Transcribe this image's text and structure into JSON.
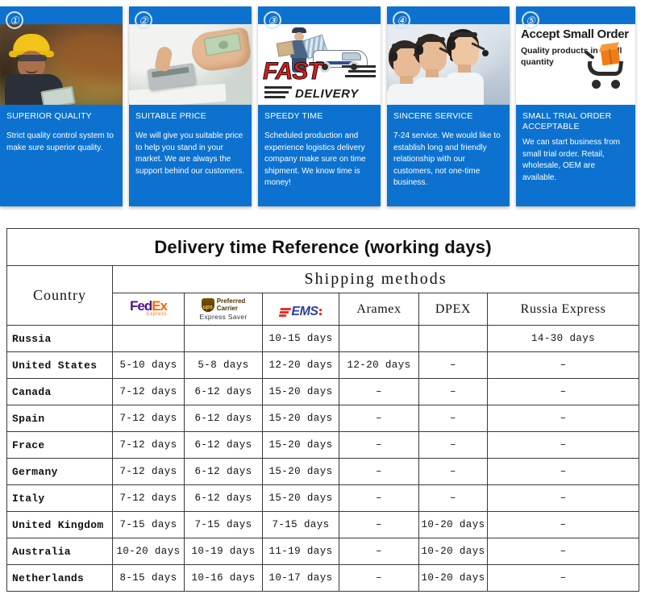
{
  "cards": [
    {
      "number": "①",
      "title": "SUPERIOR QUALITY",
      "body": "Strict quality control system to make sure superior quality.",
      "image_name": "factory-worker-photo"
    },
    {
      "number": "②",
      "title": "SUITABLE PRICE",
      "body": "We will give you suitable price to help you stand in your market. We are always the support behind our customers.",
      "image_name": "calculator-money-photo"
    },
    {
      "number": "③",
      "title": "SPEEDY TIME",
      "body": "Scheduled production and experience logistics delivery company make sure on time shipment. We know time is money!",
      "image_name": "fast-delivery-graphic",
      "graphic": {
        "word1": "FAST",
        "word2": "DELIVERY"
      }
    },
    {
      "number": "④",
      "title": "SINCERE SERVICE",
      "body": "7-24 service. We would like to establish long and friendly relationship with our customers, not one-time business.",
      "image_name": "call-center-photo"
    },
    {
      "number": "⑤",
      "title": "SMALL TRIAL ORDER ACCEPTABLE",
      "body": "We can start business from small trial order. Retail, wholesale, OEM are available.",
      "image_name": "accept-small-order-banner",
      "graphic": {
        "heading": "Accept Small Order",
        "subheading": "Quality products in small quantity"
      }
    }
  ],
  "table": {
    "title": "Delivery time Reference (working days)",
    "country_header": "Country",
    "group_header": "Shipping methods",
    "carriers": [
      {
        "id": "fedex",
        "label": "FedEx",
        "logo": "fedex-logo",
        "parts": {
          "a": "Fed",
          "b": "Ex",
          "sub": "Express"
        }
      },
      {
        "id": "ups",
        "label": "UPS",
        "logo": "ups-logo",
        "parts": {
          "mark": "ups",
          "line1": "Preferred",
          "line2": "Carrier",
          "sub": "Express Saver"
        }
      },
      {
        "id": "ems",
        "label": "EMS",
        "logo": "ems-logo",
        "parts": {
          "word": "EMS"
        }
      },
      {
        "id": "aramex",
        "label": "Aramex",
        "logo": "text"
      },
      {
        "id": "dpex",
        "label": "DPEX",
        "logo": "text"
      },
      {
        "id": "russia",
        "label": "Russia Express",
        "logo": "text"
      }
    ],
    "rows": [
      {
        "country": "Russia",
        "values": [
          "",
          "",
          "10-15 days",
          "",
          "",
          "14-30 days"
        ]
      },
      {
        "country": "United States",
        "values": [
          "5-10 days",
          "5-8 days",
          "12-20 days",
          "12-20 days",
          "–",
          "–"
        ]
      },
      {
        "country": "Canada",
        "values": [
          "7-12 days",
          "6-12 days",
          "15-20 days",
          "–",
          "–",
          "–"
        ]
      },
      {
        "country": "Spain",
        "values": [
          "7-12 days",
          "6-12 days",
          "15-20 days",
          "–",
          "–",
          "–"
        ]
      },
      {
        "country": "Frace",
        "values": [
          "7-12 days",
          "6-12 days",
          "15-20 days",
          "–",
          "–",
          "–"
        ]
      },
      {
        "country": "Germany",
        "values": [
          "7-12 days",
          "6-12 days",
          "15-20 days",
          "–",
          "–",
          "–"
        ]
      },
      {
        "country": "Italy",
        "values": [
          "7-12 days",
          "6-12 days",
          "15-20 days",
          "–",
          "–",
          "–"
        ]
      },
      {
        "country": "United Kingdom",
        "values": [
          "7-15 days",
          "7-15 days",
          "7-15 days",
          "–",
          "10-20 days",
          "–"
        ]
      },
      {
        "country": "Australia",
        "values": [
          "10-20 days",
          "10-19 days",
          "11-19 days",
          "–",
          "10-20 days",
          "–"
        ]
      },
      {
        "country": "Netherlands",
        "values": [
          "8-15 days",
          "10-16 days",
          "10-17 days",
          "–",
          "10-20 days",
          "–"
        ]
      }
    ]
  },
  "colors": {
    "card_blue": "#0d72cf",
    "title_red": "#f21616",
    "fedex_purple": "#4d148c",
    "fedex_orange": "#ff6600",
    "ups_brown": "#4b3100",
    "ems_blue": "#2b3f9e",
    "ems_red": "#e8312a",
    "border": "#3a3a3a"
  }
}
